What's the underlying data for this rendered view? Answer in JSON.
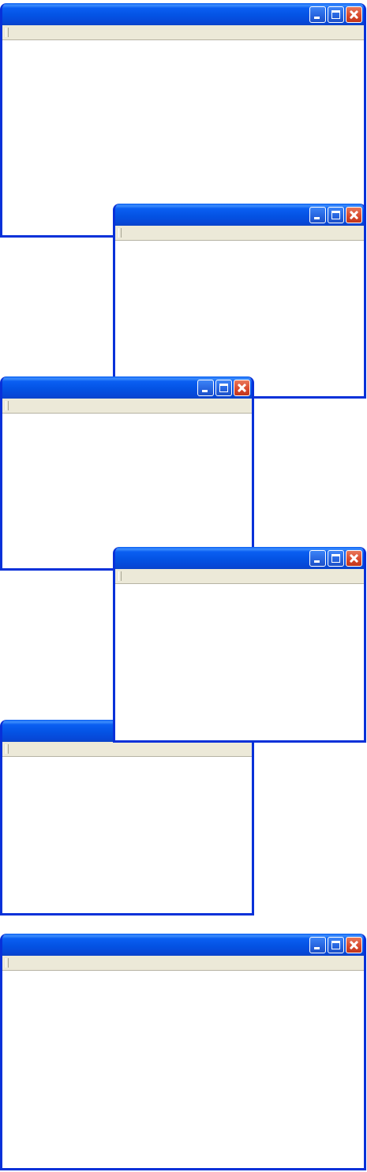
{
  "windows": [
    {
      "id": "window-1",
      "title": "",
      "controls": [
        "minimize-icon",
        "maximize-icon",
        "close-icon"
      ]
    },
    {
      "id": "window-2",
      "title": "",
      "controls": [
        "minimize-icon",
        "maximize-icon",
        "close-icon"
      ]
    },
    {
      "id": "window-3",
      "title": "",
      "controls": [
        "minimize-icon",
        "maximize-icon",
        "close-icon"
      ]
    },
    {
      "id": "window-4",
      "title": "",
      "controls": [
        "minimize-icon",
        "maximize-icon",
        "close-icon"
      ]
    },
    {
      "id": "window-5",
      "title": "",
      "controls": []
    },
    {
      "id": "window-6",
      "title": "",
      "controls": [
        "minimize-icon",
        "maximize-icon",
        "close-icon"
      ]
    }
  ],
  "colors": {
    "titlebar": "#0453e4",
    "frame": "#0831d9",
    "menubar": "#ece9d8",
    "close_button": "#d8472a",
    "client": "#ffffff"
  }
}
